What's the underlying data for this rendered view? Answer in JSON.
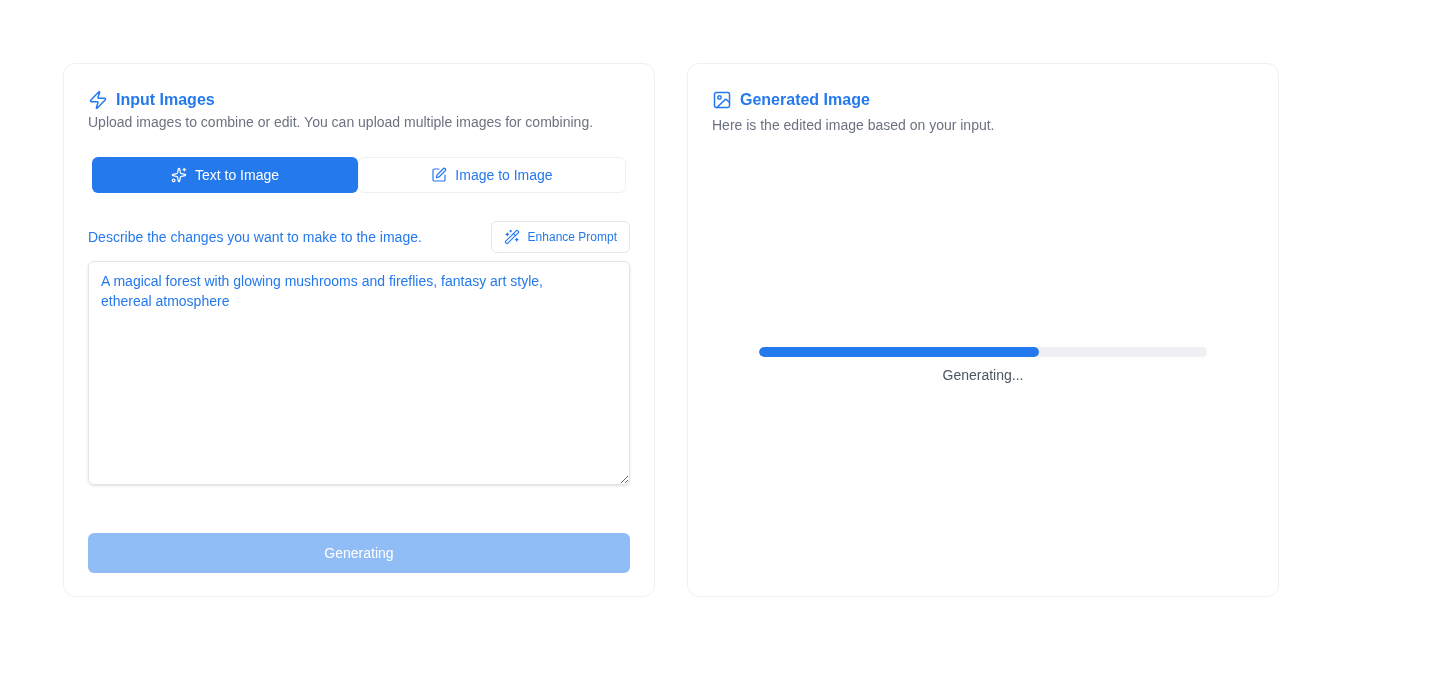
{
  "input_panel": {
    "title": "Input Images",
    "description": "Upload images to combine or edit. You can upload multiple images for combining.",
    "tabs": [
      {
        "label": "Text to Image",
        "selected": true
      },
      {
        "label": "Image to Image",
        "selected": false
      }
    ],
    "prompt_label": "Describe the changes you want to make to the image.",
    "enhance_button": "Enhance Prompt",
    "prompt_value": "A magical forest with glowing mushrooms and fireflies, fantasy art style, ethereal atmosphere",
    "generate_button": {
      "label": "Generating",
      "disabled": true
    }
  },
  "output_panel": {
    "title": "Generated Image",
    "description": "Here is the edited image based on your input.",
    "progress": {
      "level": 0.625,
      "label": "Generating..."
    }
  }
}
